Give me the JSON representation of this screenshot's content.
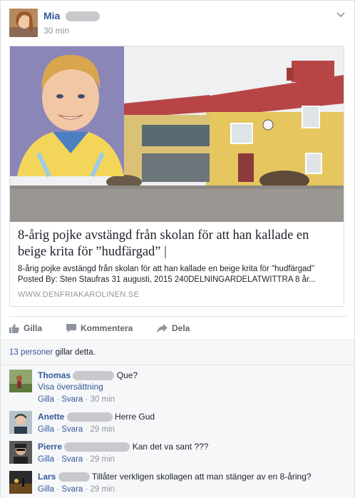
{
  "post": {
    "author": "Mia",
    "time": "30 min",
    "menu_icon": "chevron-down-icon"
  },
  "link": {
    "title": "8-årig pojke avstängd från skolan för att han kallade en beige krita för ”hudfärgad” |",
    "desc_line1": "8-årig pojke avstängd från skolan för att han kallade en beige krita för \"hudfärgad\"",
    "desc_line2": "Posted By: Sten Staufras 31 augusti, 2015 240DELNINGARDELATWITTRA 8 år...",
    "domain": "WWW.DENFRIAKAROLINEN.SE"
  },
  "actions": {
    "like": "Gilla",
    "comment": "Kommentera",
    "share": "Dela"
  },
  "likes": {
    "count_link": "13 personer",
    "text": " gillar detta."
  },
  "comments": [
    {
      "name": "Thomas",
      "text": "Que?",
      "translate": "Visa översättning",
      "like": "Gilla",
      "reply": "Svara",
      "time": "30 min"
    },
    {
      "name": "Anette",
      "text": "Herre Gud",
      "like": "Gilla",
      "reply": "Svara",
      "time": "29 min"
    },
    {
      "name": "Pierre",
      "text": "Kan det va sant ???",
      "like": "Gilla",
      "reply": "Svara",
      "time": "29 min"
    },
    {
      "name": "Lars",
      "text": "Tillåter verkligen skollagen att man stänger av en 8-åring?",
      "like": "Gilla",
      "reply": "Svara",
      "time": "29 min"
    }
  ],
  "colors": {
    "link_blue": "#365899",
    "meta_gray": "#90949c",
    "bg": "#f6f7f9"
  }
}
